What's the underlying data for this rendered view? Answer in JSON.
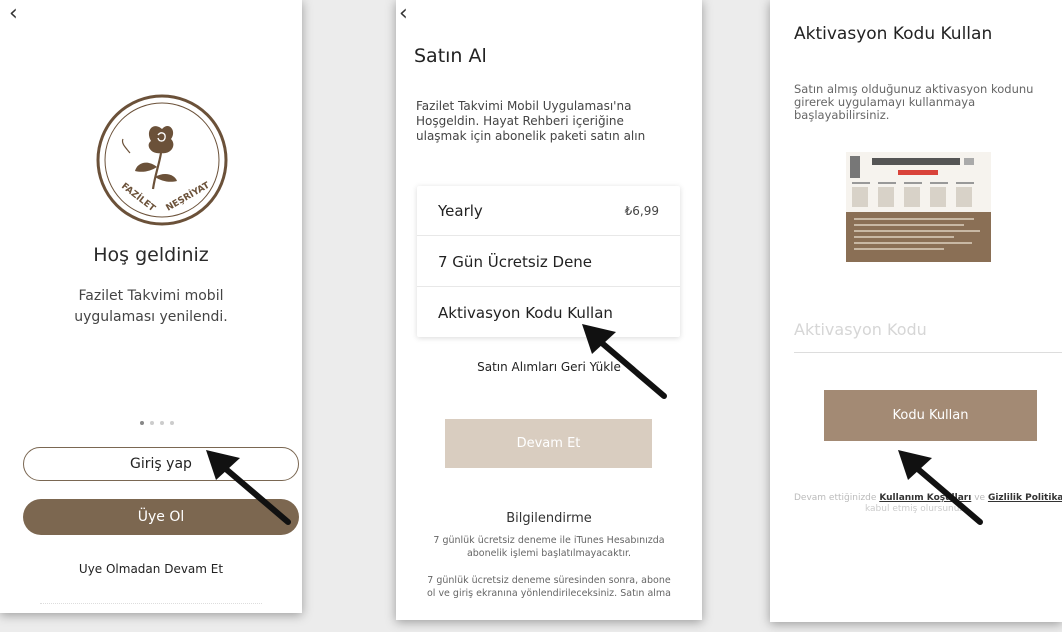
{
  "panel1": {
    "back_icon": "chevron-left-icon",
    "logo_text_left": "FAZİLET",
    "logo_text_right": "NEŞRİYAT",
    "title": "Hoş geldiniz",
    "subtitle": "Fazilet Takvimi mobil uygulaması yenilendi.",
    "login_label": "Giriş yap",
    "register_label": "Üye Ol",
    "guest_label": "Uye Olmadan Devam Et"
  },
  "panel2": {
    "back_icon": "chevron-left-icon",
    "title": "Satın Al",
    "description": "Fazilet Takvimi Mobil Uygulaması'na Hoşgeldin. Hayat Rehberi içeriğine ulaşmak için abonelik paketi satın alın",
    "options": [
      {
        "label": "Yearly",
        "price": "₺6,99"
      },
      {
        "label": "7 Gün Ücretsiz Dene",
        "price": ""
      },
      {
        "label": "Aktivasyon Kodu Kullan",
        "price": ""
      }
    ],
    "restore_label": "Satın Alımları Geri Yükle",
    "continue_label": "Devam Et",
    "info_title": "Bilgilendirme",
    "info_p1": "7 günlük ücretsiz deneme ile iTunes Hesabınızda abonelik işlemi başlatılmayacaktır.",
    "info_p2": "7 günlük ücretsiz deneme süresinden sonra, abone ol ve giriş ekranına yönlendirileceksiniz. Satın alma"
  },
  "panel3": {
    "title": "Aktivasyon Kodu Kullan",
    "description": "Satın almış olduğunuz aktivasyon kodunu girerek uygulamayı kullanmaya başlayabilirsiniz.",
    "code_placeholder": "Aktivasyon Kodu",
    "submit_label": "Kodu Kullan",
    "terms_prefix": "Devam ettiğinizde",
    "terms_link": "Kullanım Koşulları",
    "terms_and": "ve",
    "privacy_link": "Gizlilik Politikası",
    "terms_suffix": "kabul etmiş olursunuz."
  },
  "colors": {
    "brand_brown": "#7c6750",
    "disabled_button": "#d9cdc0",
    "code_button": "#a38a74"
  }
}
